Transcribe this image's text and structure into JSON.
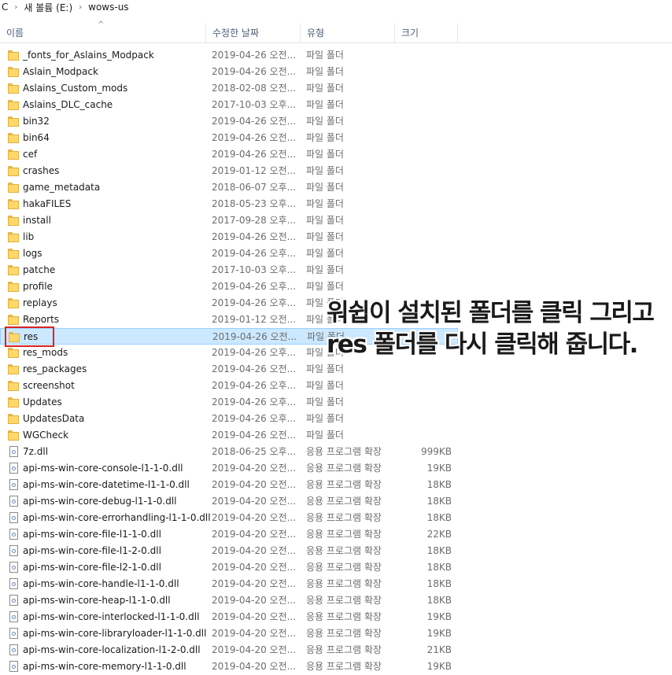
{
  "address_bar": {
    "prefix": "C",
    "crumbs": [
      "새 볼륨 (E:)",
      "wows-us"
    ]
  },
  "columns": {
    "name": "이름",
    "date": "수정한 날짜",
    "type": "유형",
    "size": "크기"
  },
  "selected_index": 17,
  "rows": [
    {
      "kind": "folder",
      "name": "_fonts_for_Aslains_Modpack",
      "date": "2019-04-26 오전...",
      "type": "파일 폴더",
      "size": ""
    },
    {
      "kind": "folder",
      "name": "Aslain_Modpack",
      "date": "2019-04-26 오전...",
      "type": "파일 폴더",
      "size": ""
    },
    {
      "kind": "folder",
      "name": "Aslains_Custom_mods",
      "date": "2018-02-08 오전...",
      "type": "파일 폴더",
      "size": ""
    },
    {
      "kind": "folder",
      "name": "Aslains_DLC_cache",
      "date": "2017-10-03 오후...",
      "type": "파일 폴더",
      "size": ""
    },
    {
      "kind": "folder",
      "name": "bin32",
      "date": "2019-04-26 오전...",
      "type": "파일 폴더",
      "size": ""
    },
    {
      "kind": "folder",
      "name": "bin64",
      "date": "2019-04-26 오전...",
      "type": "파일 폴더",
      "size": ""
    },
    {
      "kind": "folder",
      "name": "cef",
      "date": "2019-04-26 오전...",
      "type": "파일 폴더",
      "size": ""
    },
    {
      "kind": "folder",
      "name": "crashes",
      "date": "2019-01-12 오전...",
      "type": "파일 폴더",
      "size": ""
    },
    {
      "kind": "folder",
      "name": "game_metadata",
      "date": "2018-06-07 오후...",
      "type": "파일 폴더",
      "size": ""
    },
    {
      "kind": "folder",
      "name": "hakaFILES",
      "date": "2018-05-23 오후...",
      "type": "파일 폴더",
      "size": ""
    },
    {
      "kind": "folder",
      "name": "install",
      "date": "2017-09-28 오후...",
      "type": "파일 폴더",
      "size": ""
    },
    {
      "kind": "folder",
      "name": "lib",
      "date": "2019-04-26 오전...",
      "type": "파일 폴더",
      "size": ""
    },
    {
      "kind": "folder",
      "name": "logs",
      "date": "2019-04-26 오후...",
      "type": "파일 폴더",
      "size": ""
    },
    {
      "kind": "folder",
      "name": "patche",
      "date": "2017-10-03 오후...",
      "type": "파일 폴더",
      "size": ""
    },
    {
      "kind": "folder",
      "name": "profile",
      "date": "2019-04-26 오후...",
      "type": "파일 폴더",
      "size": ""
    },
    {
      "kind": "folder",
      "name": "replays",
      "date": "2019-04-26 오후...",
      "type": "파일 폴더",
      "size": ""
    },
    {
      "kind": "folder",
      "name": "Reports",
      "date": "2019-01-12 오전...",
      "type": "파일 폴더",
      "size": ""
    },
    {
      "kind": "folder",
      "name": "res",
      "date": "2019-04-26 오전...",
      "type": "파일 폴더",
      "size": ""
    },
    {
      "kind": "folder",
      "name": "res_mods",
      "date": "2019-04-26 오후...",
      "type": "파일 폴더",
      "size": ""
    },
    {
      "kind": "folder",
      "name": "res_packages",
      "date": "2019-04-26 오전...",
      "type": "파일 폴더",
      "size": ""
    },
    {
      "kind": "folder",
      "name": "screenshot",
      "date": "2019-04-26 오후...",
      "type": "파일 폴더",
      "size": ""
    },
    {
      "kind": "folder",
      "name": "Updates",
      "date": "2019-04-26 오후...",
      "type": "파일 폴더",
      "size": ""
    },
    {
      "kind": "folder",
      "name": "UpdatesData",
      "date": "2019-04-26 오후...",
      "type": "파일 폴더",
      "size": ""
    },
    {
      "kind": "folder",
      "name": "WGCheck",
      "date": "2019-04-26 오전...",
      "type": "파일 폴더",
      "size": ""
    },
    {
      "kind": "file",
      "name": "7z.dll",
      "date": "2018-06-25 오후...",
      "type": "응용 프로그램 확장",
      "size": "999KB"
    },
    {
      "kind": "file",
      "name": "api-ms-win-core-console-l1-1-0.dll",
      "date": "2019-04-20 오전...",
      "type": "응용 프로그램 확장",
      "size": "19KB"
    },
    {
      "kind": "file",
      "name": "api-ms-win-core-datetime-l1-1-0.dll",
      "date": "2019-04-20 오전...",
      "type": "응용 프로그램 확장",
      "size": "18KB"
    },
    {
      "kind": "file",
      "name": "api-ms-win-core-debug-l1-1-0.dll",
      "date": "2019-04-20 오전...",
      "type": "응용 프로그램 확장",
      "size": "18KB"
    },
    {
      "kind": "file",
      "name": "api-ms-win-core-errorhandling-l1-1-0.dll",
      "date": "2019-04-20 오전...",
      "type": "응용 프로그램 확장",
      "size": "18KB"
    },
    {
      "kind": "file",
      "name": "api-ms-win-core-file-l1-1-0.dll",
      "date": "2019-04-20 오전...",
      "type": "응용 프로그램 확장",
      "size": "22KB"
    },
    {
      "kind": "file",
      "name": "api-ms-win-core-file-l1-2-0.dll",
      "date": "2019-04-20 오전...",
      "type": "응용 프로그램 확장",
      "size": "18KB"
    },
    {
      "kind": "file",
      "name": "api-ms-win-core-file-l2-1-0.dll",
      "date": "2019-04-20 오전...",
      "type": "응용 프로그램 확장",
      "size": "18KB"
    },
    {
      "kind": "file",
      "name": "api-ms-win-core-handle-l1-1-0.dll",
      "date": "2019-04-20 오전...",
      "type": "응용 프로그램 확장",
      "size": "18KB"
    },
    {
      "kind": "file",
      "name": "api-ms-win-core-heap-l1-1-0.dll",
      "date": "2019-04-20 오전...",
      "type": "응용 프로그램 확장",
      "size": "18KB"
    },
    {
      "kind": "file",
      "name": "api-ms-win-core-interlocked-l1-1-0.dll",
      "date": "2019-04-20 오전...",
      "type": "응용 프로그램 확장",
      "size": "19KB"
    },
    {
      "kind": "file",
      "name": "api-ms-win-core-libraryloader-l1-1-0.dll",
      "date": "2019-04-20 오전...",
      "type": "응용 프로그램 확장",
      "size": "19KB"
    },
    {
      "kind": "file",
      "name": "api-ms-win-core-localization-l1-2-0.dll",
      "date": "2019-04-20 오전...",
      "type": "응용 프로그램 확장",
      "size": "21KB"
    },
    {
      "kind": "file",
      "name": "api-ms-win-core-memory-l1-1-0.dll",
      "date": "2019-04-20 오전...",
      "type": "응용 프로그램 확장",
      "size": "19KB"
    }
  ],
  "annotation": {
    "line1": "워쉽이 설치된 폴더를 클릭 그리고",
    "line2": "res 폴더를 다시 클릭해 줍니다."
  },
  "colors": {
    "selection": "#cce8ff",
    "highlight_box": "#d92323",
    "folder": "#ffd869"
  }
}
